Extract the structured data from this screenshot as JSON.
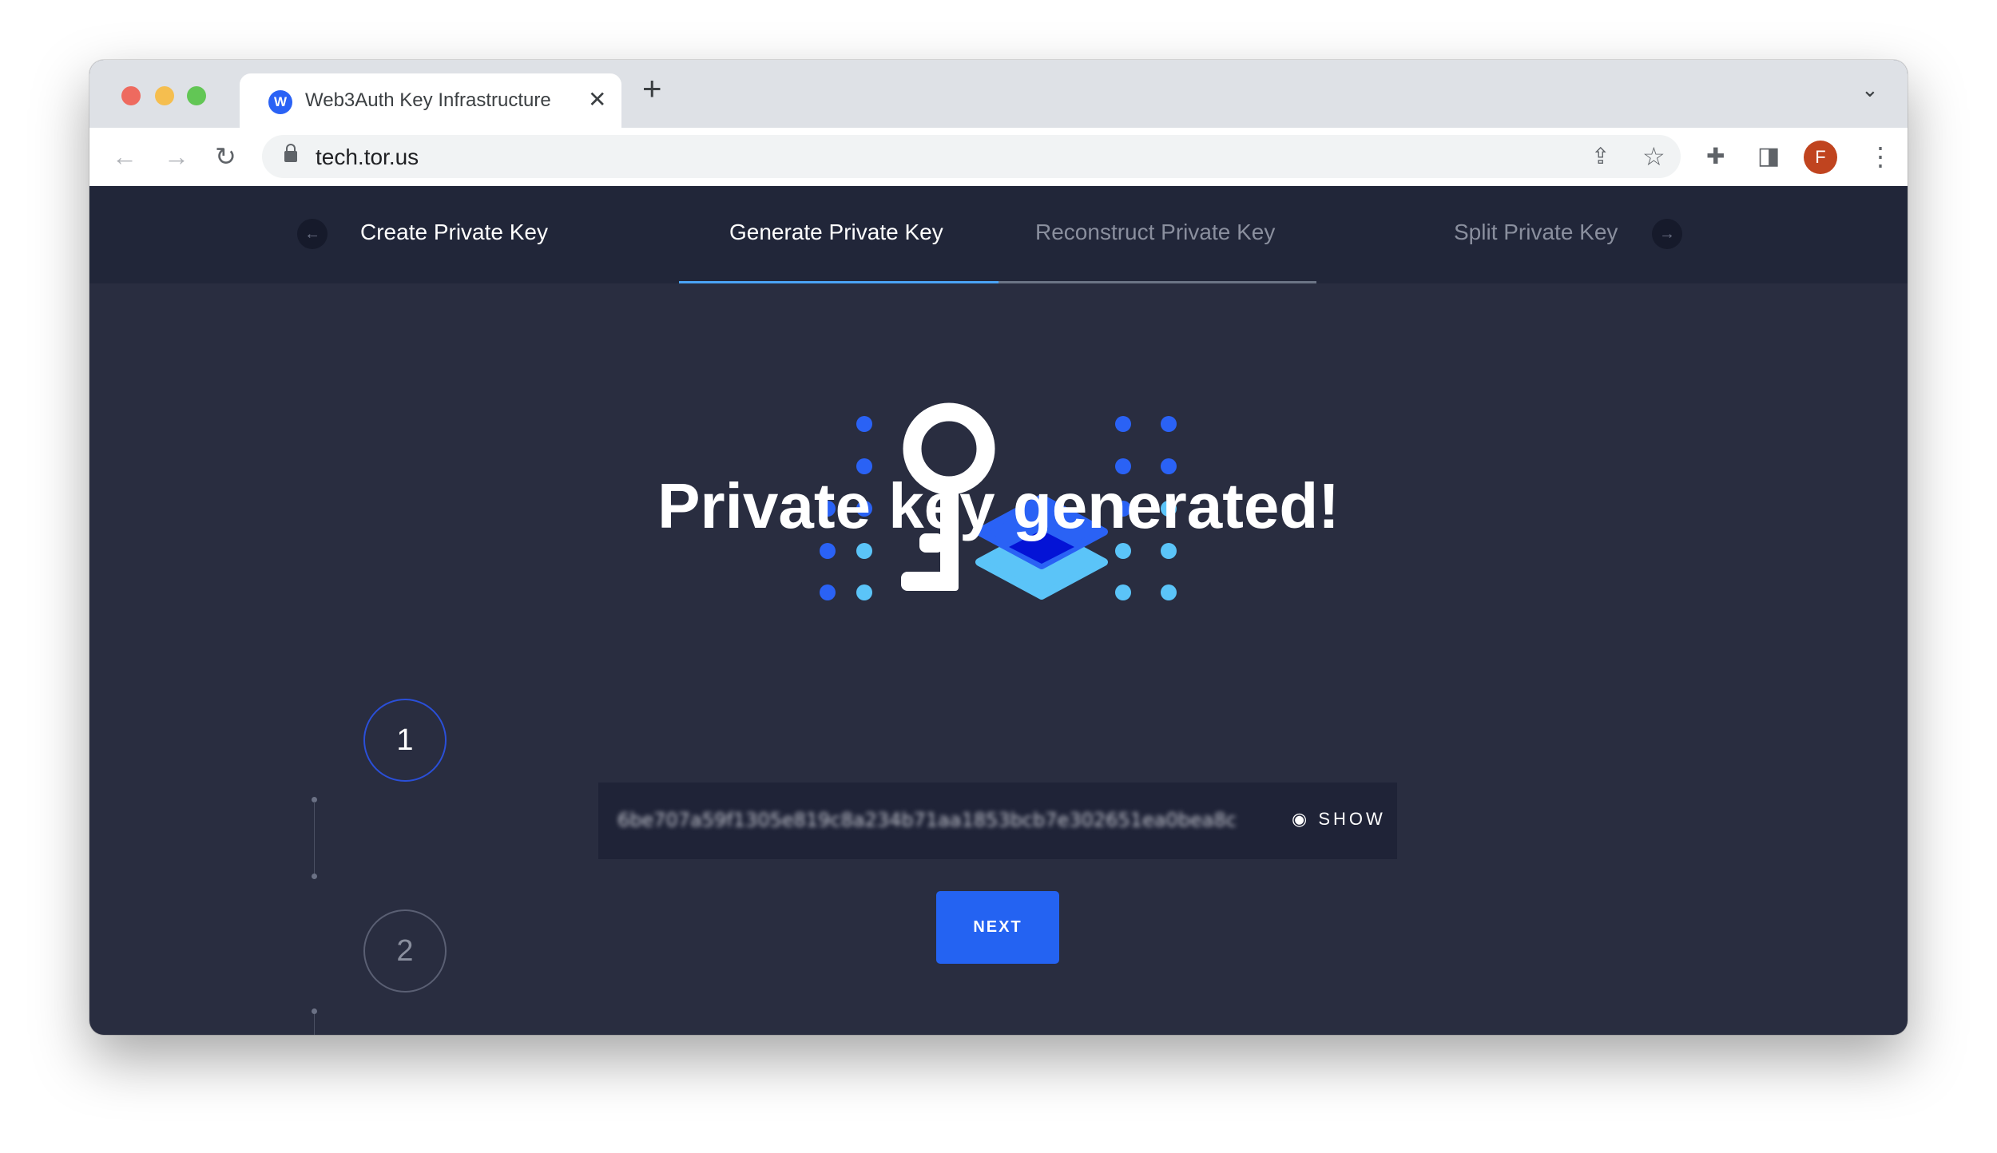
{
  "browser": {
    "tab_title": "Web3Auth Key Infrastructure",
    "favicon_letter": "W",
    "url": "tech.tor.us",
    "profile_initial": "F",
    "icons": [
      "back-arrow-icon",
      "forward-arrow-icon",
      "reload-icon",
      "lock-icon",
      "share-icon",
      "star-icon",
      "extensions-icon",
      "sidebar-icon",
      "kebab-menu-icon"
    ]
  },
  "nav": {
    "items": [
      {
        "label": "Create Private Key",
        "state": "done"
      },
      {
        "label": "Generate Private Key",
        "state": "active"
      },
      {
        "label": "Reconstruct Private Key",
        "state": "inactive"
      },
      {
        "label": "Split Private Key",
        "state": "inactive"
      }
    ],
    "progress_percent": 50
  },
  "main": {
    "heading": "Private key generated!",
    "private_key_masked": "6be707a59f1305e819c8a234b71aa1853bcb7e302651ea0bea8c",
    "show_label": "SHOW",
    "next_label": "NEXT",
    "steps": [
      "1",
      "2"
    ]
  },
  "colors": {
    "accent": "#2463f2",
    "background": "#292d40",
    "nav_bg": "#212639",
    "light_blue": "#5bc4f8"
  }
}
